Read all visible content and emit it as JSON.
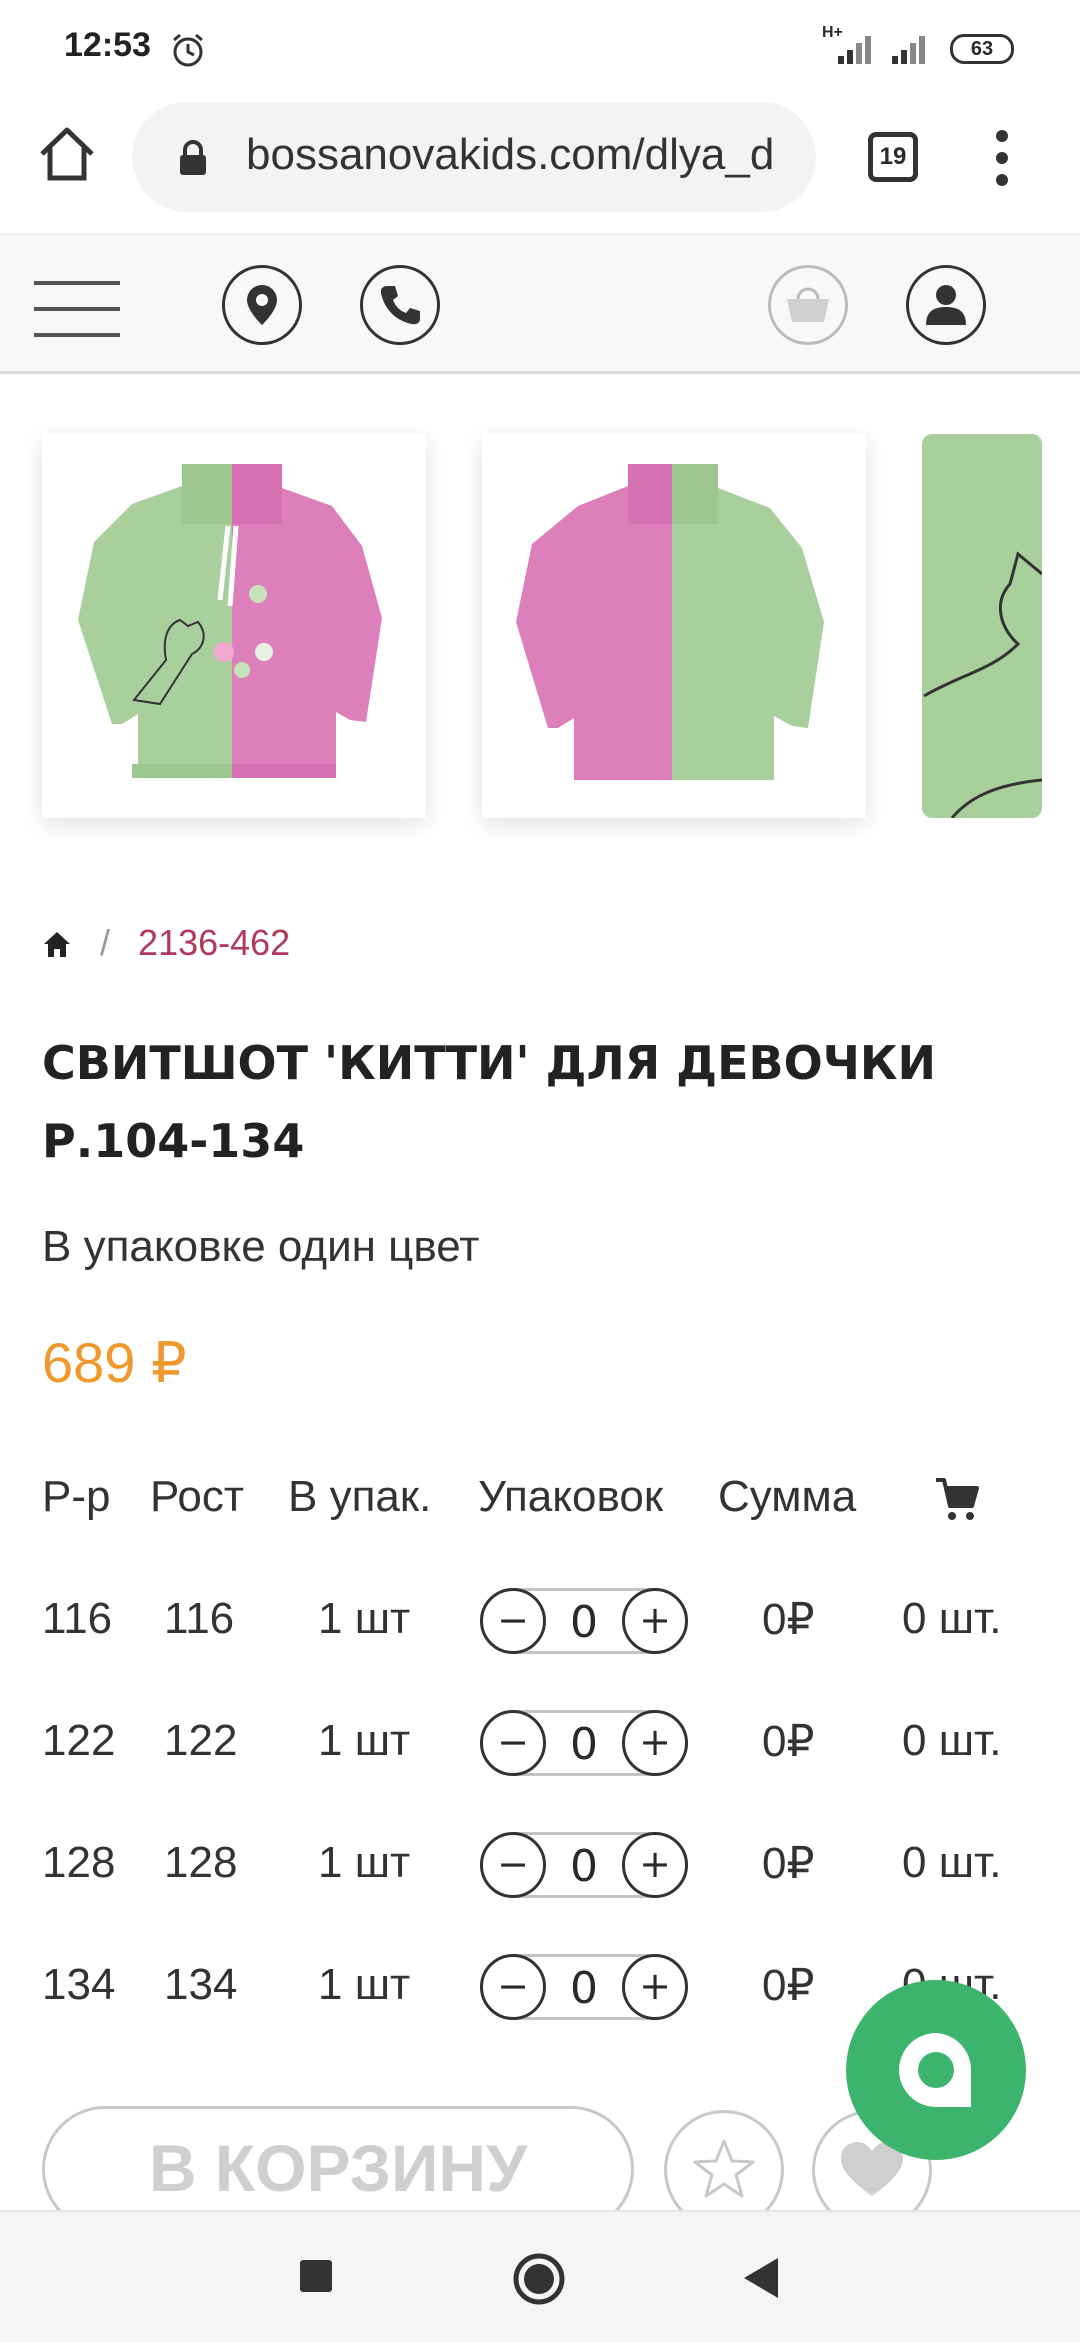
{
  "status_bar": {
    "time": "12:53",
    "network": "H+",
    "battery": "63"
  },
  "browser": {
    "url": "bossanovakids.com/dlya_d",
    "tab_count": "19"
  },
  "breadcrumb": {
    "code": "2136-462",
    "separator": "/"
  },
  "product": {
    "title": "СВИТШОТ 'КИТТИ' ДЛЯ ДЕВОЧКИ Р.104-134",
    "subtitle": "В упаковке один цвет",
    "price": "689 ₽"
  },
  "table": {
    "headers": [
      "Р-р",
      "Рост",
      "В упак.",
      "Упаковок",
      "Сумма"
    ],
    "rows": [
      {
        "size": "116",
        "height": "116",
        "pack": "1 шт",
        "qty": "0",
        "sum": "0₽",
        "count": "0 шт."
      },
      {
        "size": "122",
        "height": "122",
        "pack": "1 шт",
        "qty": "0",
        "sum": "0₽",
        "count": "0 шт."
      },
      {
        "size": "128",
        "height": "128",
        "pack": "1 шт",
        "qty": "0",
        "sum": "0₽",
        "count": "0 шт."
      },
      {
        "size": "134",
        "height": "134",
        "pack": "1 шт",
        "qty": "0",
        "sum": "0₽",
        "count": "0 шт."
      }
    ],
    "minus": "−",
    "plus": "+"
  },
  "actions": {
    "add_to_cart": "В КОРЗИНУ"
  },
  "colors": {
    "price": "#f0982b",
    "crumb": "#b03a5b",
    "chat": "#3db46d",
    "green_fabric": "#a9cf9c",
    "pink_fabric": "#dc7fbb"
  }
}
